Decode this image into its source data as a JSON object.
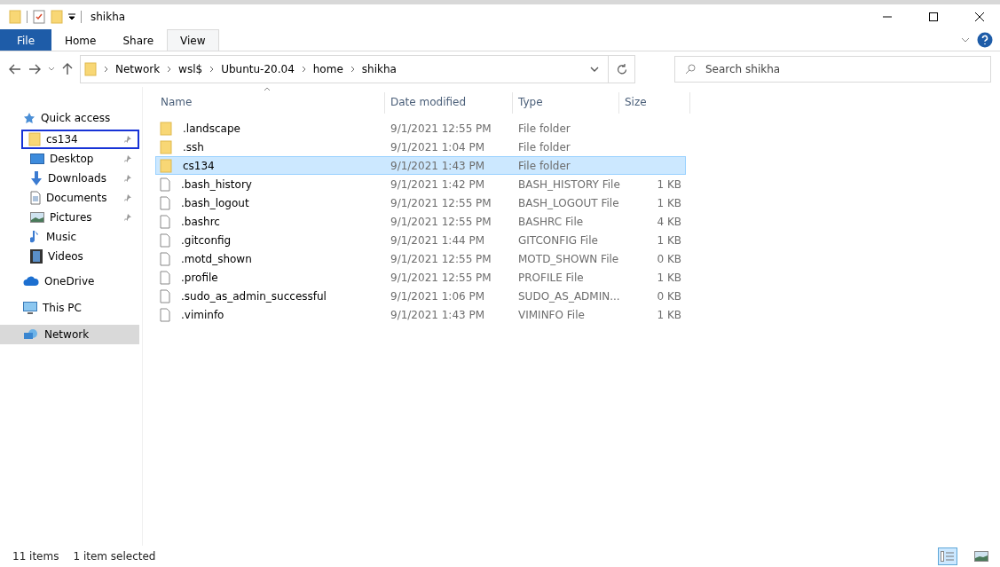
{
  "window": {
    "title": "shikha"
  },
  "ribbon_tabs": [
    {
      "label": "File",
      "selected": false,
      "kind": "file"
    },
    {
      "label": "Home",
      "selected": false,
      "kind": "tab"
    },
    {
      "label": "Share",
      "selected": false,
      "kind": "tab"
    },
    {
      "label": "View",
      "selected": true,
      "kind": "tab"
    }
  ],
  "address": {
    "crumbs": [
      "Network",
      "wsl$",
      "Ubuntu-20.04",
      "home",
      "shikha"
    ]
  },
  "search": {
    "placeholder": "Search shikha"
  },
  "sidebar": {
    "items": [
      {
        "label": "Quick access",
        "kind": "star",
        "pinned": false,
        "focused": false,
        "selected": false
      },
      {
        "label": "cs134",
        "kind": "folder",
        "pinned": true,
        "focused": true,
        "selected": false
      },
      {
        "label": "Desktop",
        "kind": "desktop",
        "pinned": true,
        "focused": false,
        "selected": false
      },
      {
        "label": "Downloads",
        "kind": "download",
        "pinned": true,
        "focused": false,
        "selected": false
      },
      {
        "label": "Documents",
        "kind": "document",
        "pinned": true,
        "focused": false,
        "selected": false
      },
      {
        "label": "Pictures",
        "kind": "picture",
        "pinned": true,
        "focused": false,
        "selected": false
      },
      {
        "label": "Music",
        "kind": "music",
        "pinned": false,
        "focused": false,
        "selected": false
      },
      {
        "label": "Videos",
        "kind": "video",
        "pinned": false,
        "focused": false,
        "selected": false
      },
      {
        "label": "OneDrive",
        "kind": "cloud",
        "pinned": false,
        "focused": false,
        "selected": false
      },
      {
        "label": "This PC",
        "kind": "pc",
        "pinned": false,
        "focused": false,
        "selected": false
      },
      {
        "label": "Network",
        "kind": "network",
        "pinned": false,
        "focused": false,
        "selected": true
      }
    ]
  },
  "table": {
    "columns": [
      "Name",
      "Date modified",
      "Type",
      "Size"
    ],
    "rows": [
      {
        "name": ".landscape",
        "date": "9/1/2021 12:55 PM",
        "type": "File folder",
        "kind": "folder",
        "selected": false
      },
      {
        "name": ".ssh",
        "date": "9/1/2021 1:04 PM",
        "type": "File folder",
        "kind": "folder",
        "selected": false
      },
      {
        "name": "cs134",
        "date": "9/1/2021 1:43 PM",
        "type": "File folder",
        "kind": "folder",
        "selected": true
      },
      {
        "name": ".bash_history",
        "date": "9/1/2021 1:42 PM",
        "type": "BASH_HISTORY File",
        "size": "1 KB",
        "kind": "file",
        "selected": false
      },
      {
        "name": ".bash_logout",
        "date": "9/1/2021 12:55 PM",
        "type": "BASH_LOGOUT File",
        "size": "1 KB",
        "kind": "file",
        "selected": false
      },
      {
        "name": ".bashrc",
        "date": "9/1/2021 12:55 PM",
        "type": "BASHRC File",
        "size": "4 KB",
        "kind": "file",
        "selected": false
      },
      {
        "name": ".gitconfig",
        "date": "9/1/2021 1:44 PM",
        "type": "GITCONFIG File",
        "size": "1 KB",
        "kind": "file",
        "selected": false
      },
      {
        "name": ".motd_shown",
        "date": "9/1/2021 12:55 PM",
        "type": "MOTD_SHOWN File",
        "size": "0 KB",
        "kind": "file",
        "selected": false
      },
      {
        "name": ".profile",
        "date": "9/1/2021 12:55 PM",
        "type": "PROFILE File",
        "size": "1 KB",
        "kind": "file",
        "selected": false
      },
      {
        "name": ".sudo_as_admin_successful",
        "date": "9/1/2021 1:06 PM",
        "type": "SUDO_AS_ADMIN...",
        "size": "0 KB",
        "kind": "file",
        "selected": false
      },
      {
        "name": ".viminfo",
        "date": "9/1/2021 1:43 PM",
        "type": "VIMINFO File",
        "size": "1 KB",
        "kind": "file",
        "selected": false
      }
    ]
  },
  "status_bar": {
    "items": "11 items",
    "selection": "1 item selected",
    "view_modes": [
      {
        "kind": "details",
        "selected": true
      },
      {
        "kind": "tiles",
        "selected": false
      }
    ]
  }
}
